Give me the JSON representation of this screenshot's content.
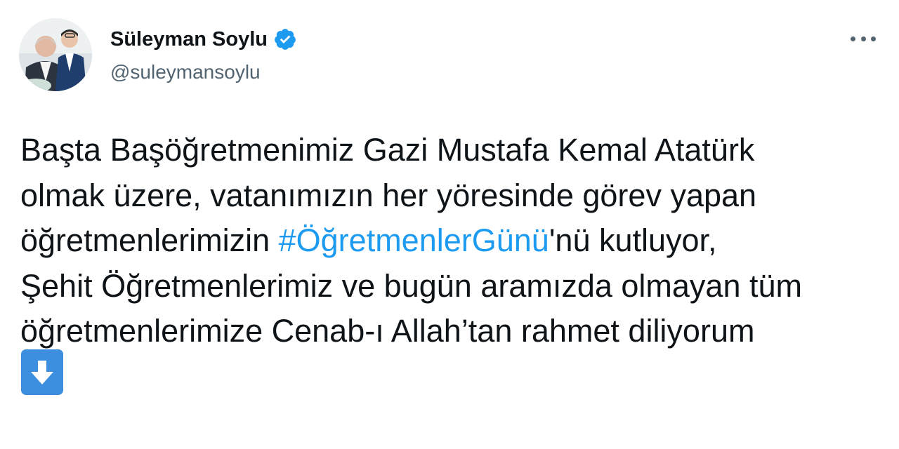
{
  "author": {
    "display_name": "Süleyman Soylu",
    "handle": "@suleymansoylu",
    "verified": true,
    "avatar_icon": "profile-photo"
  },
  "menu": {
    "icon": "more-options-icon"
  },
  "tweet": {
    "lines": [
      "Başta Başöğretmenimiz Gazi Mustafa Kemal Atatürk",
      "olmak üzere, vatanımızın her yöresinde görev yapan",
      "öğretmenlerimizin ",
      "'nü kutluyor,",
      "Şehit Öğretmenlerimiz ve bugün aramızda olmayan tüm",
      "öğretmenlerimize Cenab-ı Allah’tan rahmet diliyorum"
    ],
    "hashtag": "#ÖğretmenlerGünü",
    "emoji": "down-arrow-emoji",
    "emoji_color": "#3c8fdf"
  },
  "colors": {
    "text": "#0f1419",
    "secondary": "#536471",
    "link": "#1d9bf0",
    "verified": "#1d9bf0"
  }
}
